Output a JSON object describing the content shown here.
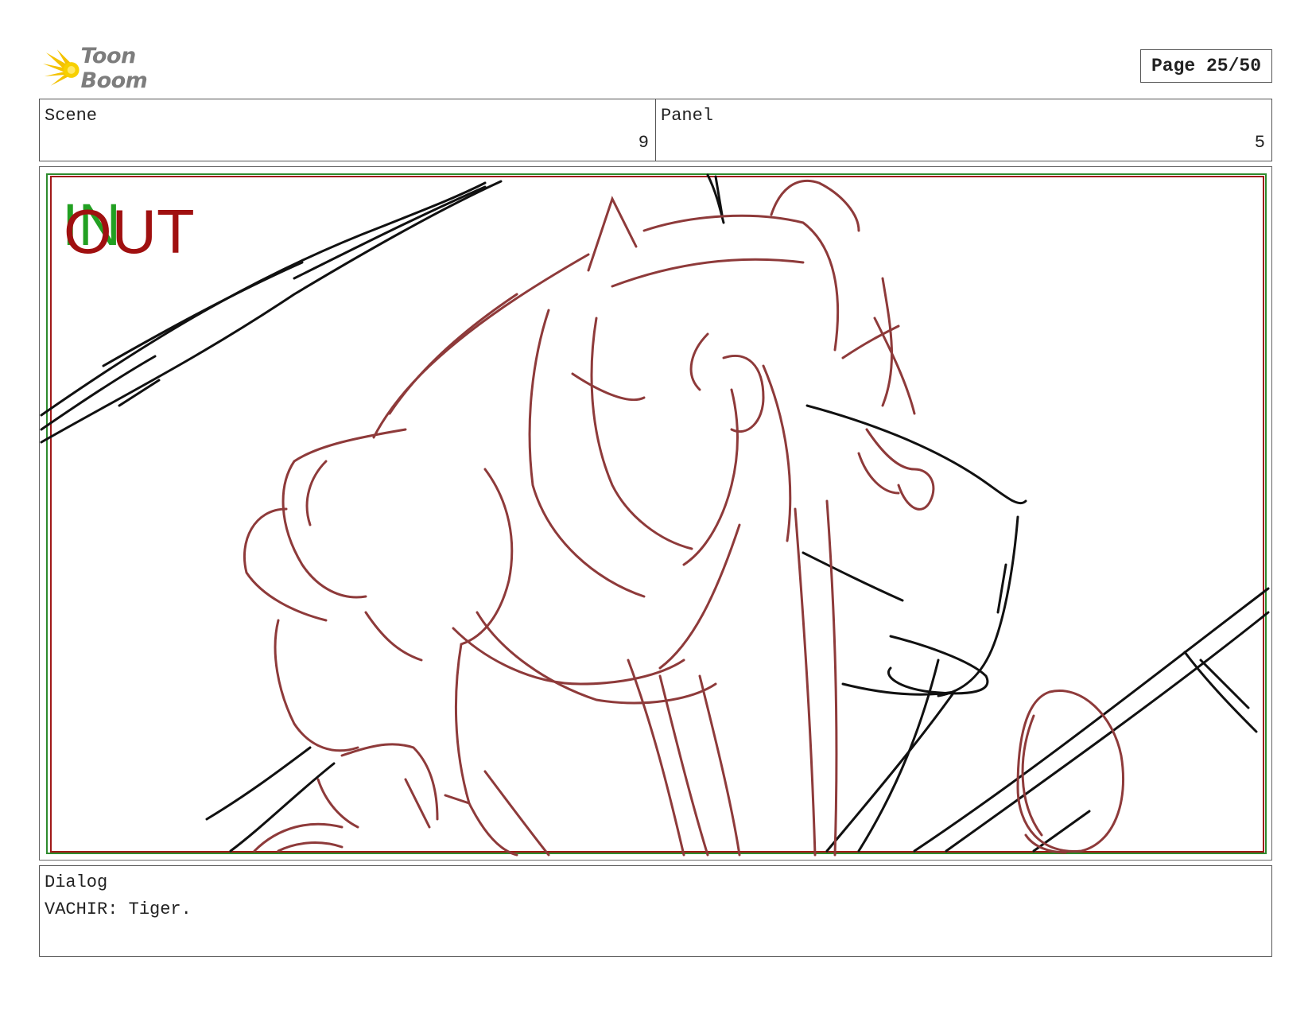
{
  "header": {
    "brand_name": "Toon Boom",
    "page_label": "Page 25/50"
  },
  "info": {
    "scene_label": "Scene",
    "scene_value": "9",
    "panel_label": "Panel",
    "panel_value": "5"
  },
  "artwork": {
    "in_marker": "IN",
    "out_marker": "OUT",
    "in_color": "#22a022",
    "out_color": "#a01010",
    "sketch_color": "#8e3a3a",
    "line_color": "#111111",
    "safe_frame_colors": [
      "#2e8b2e",
      "#a01818"
    ]
  },
  "dialog": {
    "label": "Dialog",
    "text": "VACHIR: Tiger."
  }
}
